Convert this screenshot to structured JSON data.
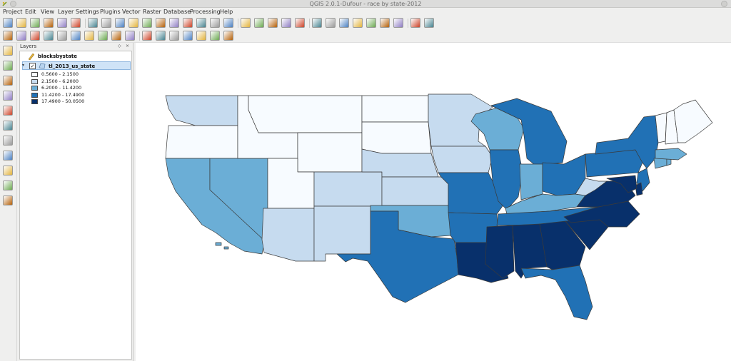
{
  "window": {
    "title": "QGIS 2.0.1-Dufour - race by state-2012"
  },
  "menu": {
    "items": [
      "Project",
      "Edit",
      "View",
      "Layer",
      "Settings",
      "Plugins",
      "Vector",
      "Raster",
      "Database",
      "Processing",
      "Help"
    ]
  },
  "toolbar": {
    "row1_icons": [
      "new-project-icon",
      "open-project-icon",
      "save-project-icon",
      "save-as-icon",
      "new-print-composer-icon",
      "composer-manager-icon",
      "pan-icon",
      "pan-to-selection-icon",
      "zoom-in-icon",
      "zoom-out-icon",
      "zoom-actual-icon",
      "zoom-full-icon",
      "zoom-to-selection-icon",
      "zoom-to-layer-icon",
      "zoom-last-icon",
      "zoom-next-icon",
      "refresh-icon",
      "identify-icon",
      "run-action-icon",
      "select-icon",
      "deselect-icon",
      "expression-select-icon",
      "attribute-table-icon",
      "field-calculator-icon",
      "measure-icon",
      "map-tips-icon",
      "new-bookmark-icon",
      "show-bookmarks-icon",
      "text-annotation-icon",
      "help-icon",
      "whats-this-icon"
    ],
    "row2_icons": [
      "current-edits-icon",
      "toggle-editing-icon",
      "save-edits-icon",
      "add-feature-icon",
      "move-feature-icon",
      "node-tool-icon",
      "delete-selected-icon",
      "cut-features-icon",
      "copy-features-icon",
      "paste-features-icon",
      "label-icon",
      "pin-labels-icon",
      "show-hide-labels-icon",
      "move-label-icon",
      "rotate-label-icon",
      "change-label-icon",
      "label-tool-icon"
    ]
  },
  "left_toolbar": {
    "icons": [
      "add-vector-layer-icon",
      "add-raster-layer-icon",
      "add-postgis-layer-icon",
      "add-spatialite-layer-icon",
      "add-mssql-layer-icon",
      "add-oracle-layer-icon",
      "add-wms-layer-icon",
      "add-wcs-layer-icon",
      "add-wfs-layer-icon",
      "new-shapefile-icon",
      "remove-layer-icon"
    ]
  },
  "layers_panel": {
    "title": "Layers",
    "header_buttons": [
      "◇",
      "×"
    ],
    "layers": [
      {
        "name": "blacksbystate",
        "type": "table",
        "checked": false
      },
      {
        "name": "tl_2013_us_state",
        "type": "polygon",
        "checked": true,
        "selected": true
      }
    ],
    "legend": [
      {
        "range": "0.5600 - 2.1500",
        "color": "#f7fbff"
      },
      {
        "range": "2.1500 - 6.2000",
        "color": "#c6dbef"
      },
      {
        "range": "6.2000 - 11.4200",
        "color": "#6baed6"
      },
      {
        "range": "11.4200 - 17.4900",
        "color": "#2171b5"
      },
      {
        "range": "17.4900 - 50.0500",
        "color": "#08306b"
      }
    ]
  },
  "map": {
    "classes": {
      "c1": "#f7fbff",
      "c2": "#c6dbef",
      "c3": "#6baed6",
      "c4": "#2171b5",
      "c5": "#08306b"
    }
  }
}
